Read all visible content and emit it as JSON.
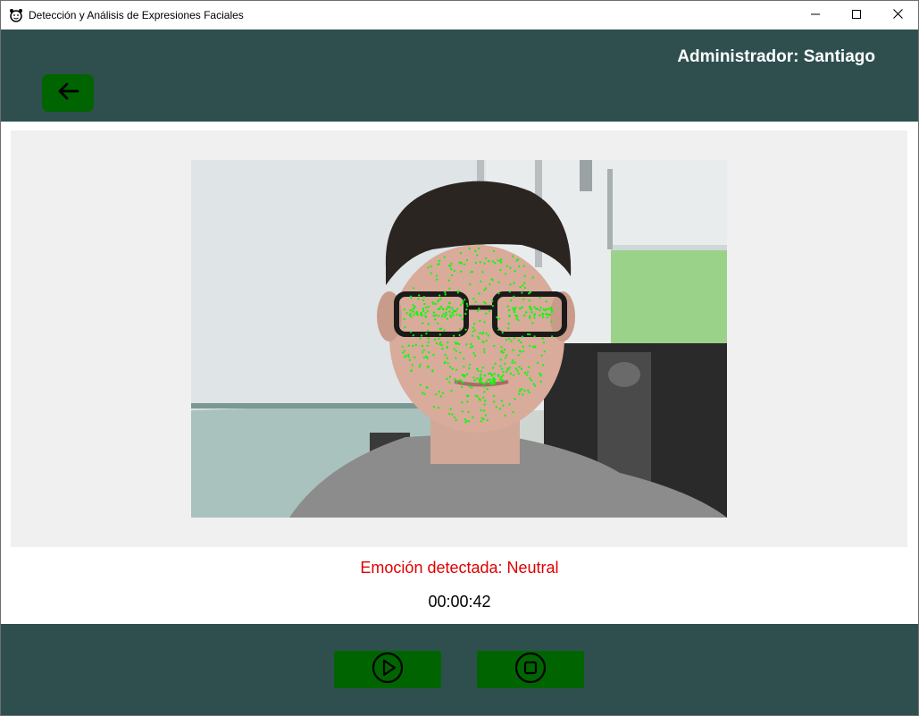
{
  "window": {
    "title": "Detección y Análisis de Expresiones Faciales",
    "icons": {
      "app": "alarm-clock-face-icon",
      "minimize": "minimize-icon",
      "maximize": "maximize-icon",
      "close": "close-icon"
    }
  },
  "header": {
    "admin_label": "Administrador: Santiago",
    "back_icon": "arrow-left-icon",
    "back_button_color": "#006400"
  },
  "video": {
    "overlay_color": "#00ff00",
    "description_icon": "webcam-feed"
  },
  "status": {
    "emotion_text": "Emoción detectada: Neutral",
    "timer": "00:00:42"
  },
  "controls": {
    "play_icon": "play-circle-icon",
    "stop_icon": "stop-circle-icon"
  },
  "colors": {
    "bar": "#2f4f4f",
    "button": "#006400",
    "emotion": "#e00000",
    "panel": "#f0f0f0"
  }
}
